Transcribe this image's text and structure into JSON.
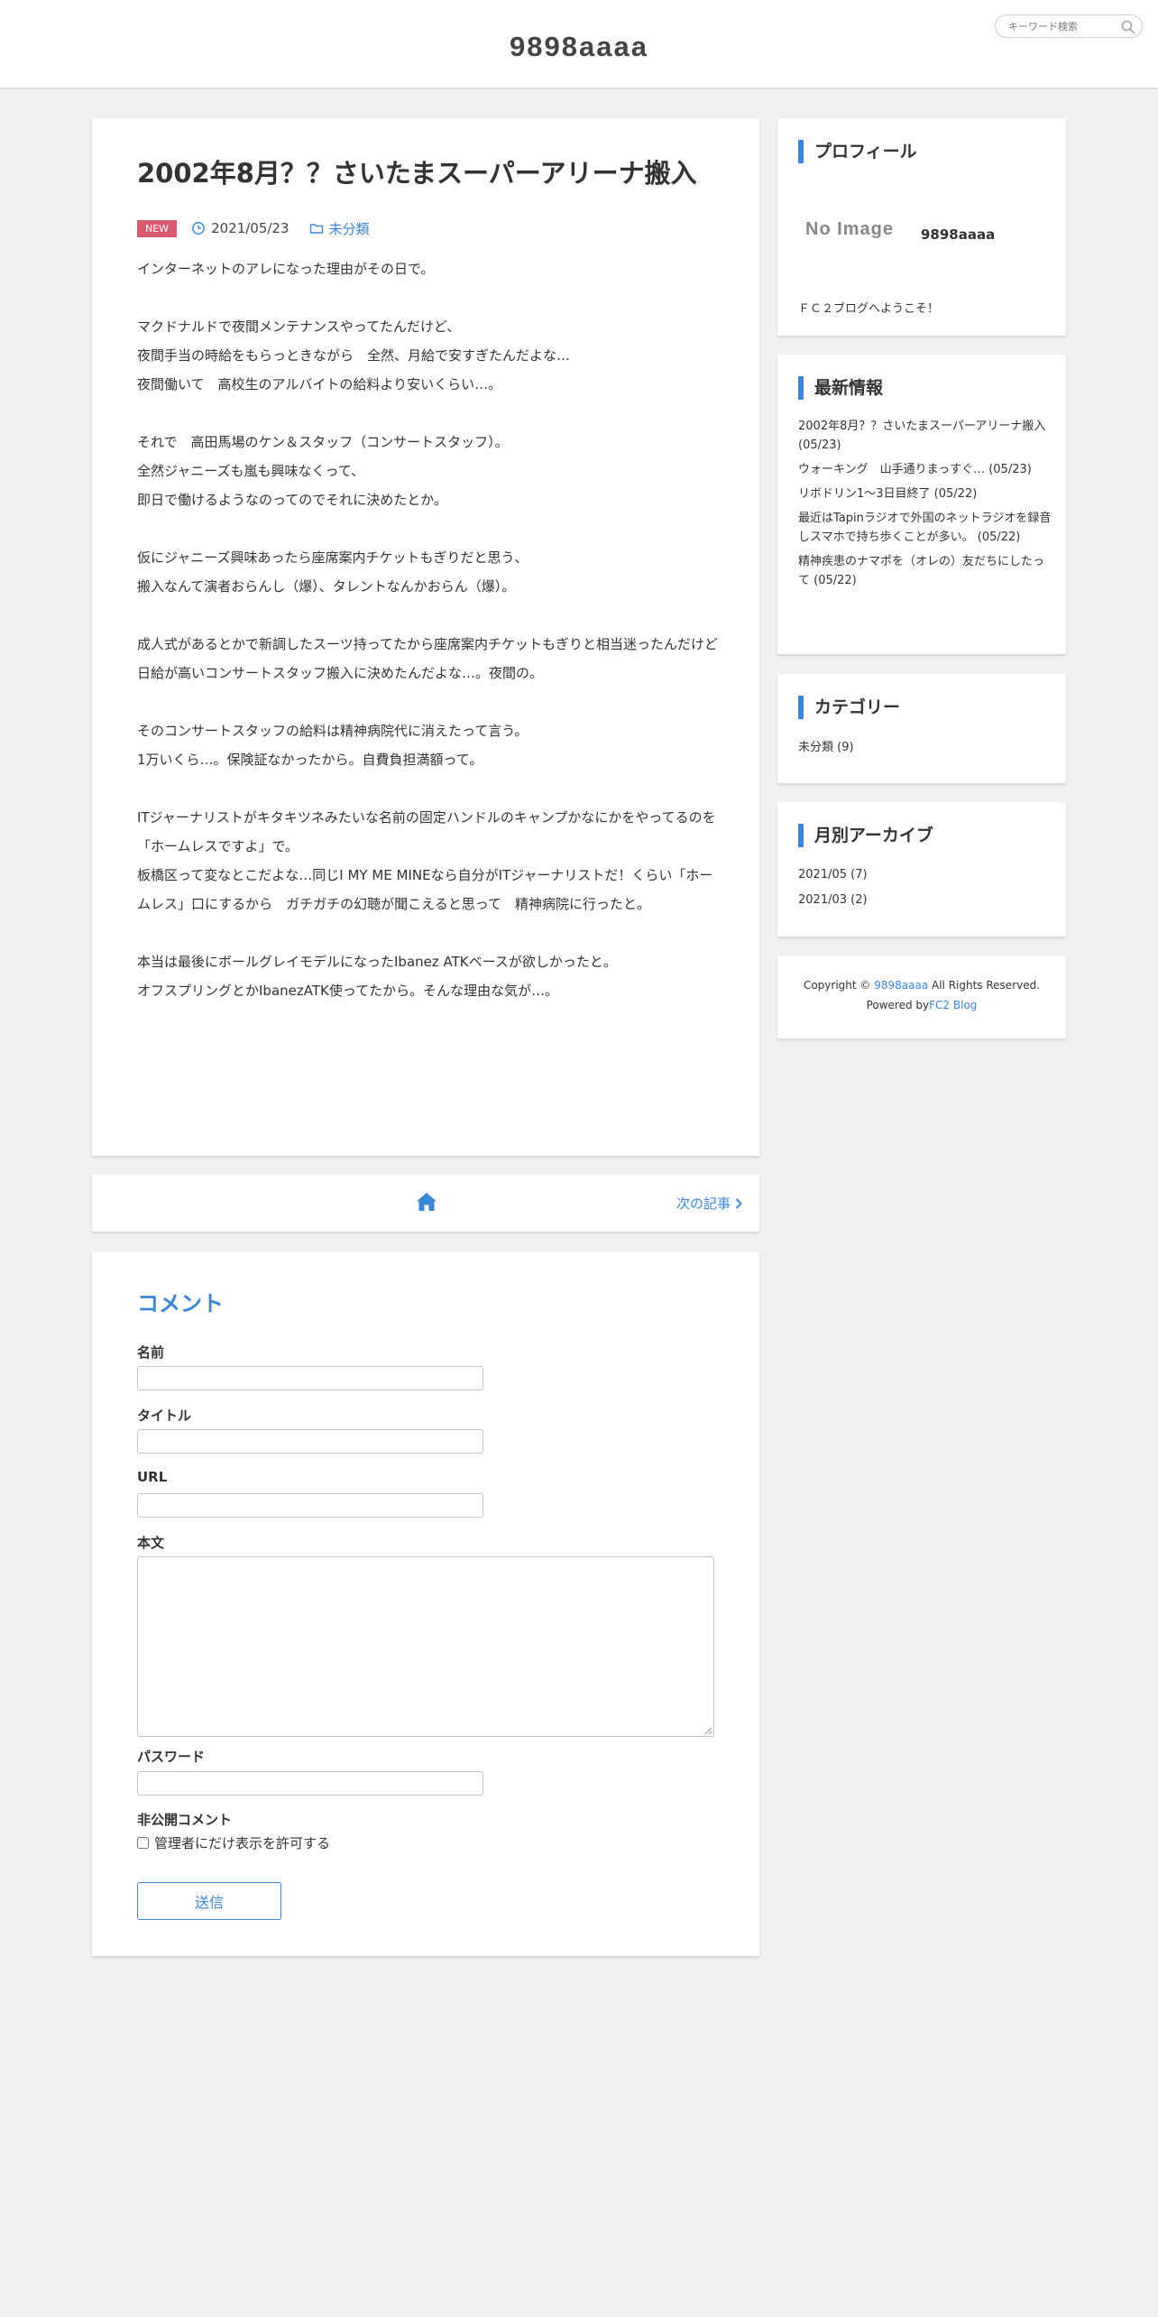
{
  "header": {
    "site_title": "9898aaaa",
    "search_placeholder": "キーワード検索"
  },
  "article": {
    "title": "2002年8月？？さいたまスーパーアリーナ搬入",
    "badge": "NEW",
    "date": "2021/05/23",
    "category": "未分類",
    "paragraphs": [
      [
        "インターネットのアレになった理由がその日で。"
      ],
      [
        "マクドナルドで夜間メンテナンスやってたんだけど、",
        "夜間手当の時給をもらっときながら　全然、月給で安すぎたんだよな…",
        "夜間働いて　高校生のアルバイトの給料より安いくらい…。"
      ],
      [
        "それで　高田馬場のケン＆スタッフ（コンサートスタッフ）。",
        "全然ジャニーズも嵐も興味なくって、",
        "即日で働けるようなのってのでそれに決めたとか。"
      ],
      [
        "仮にジャニーズ興味あったら座席案内チケットもぎりだと思う、",
        "搬入なんて演者おらんし（爆）、タレントなんかおらん（爆）。"
      ],
      [
        "成人式があるとかで新調したスーツ持ってたから座席案内チケットもぎりと相当迷ったんだけど日給が高いコンサートスタッフ搬入に決めたんだよな…。夜間の。"
      ],
      [
        "そのコンサートスタッフの給料は精神病院代に消えたって言う。",
        "1万いくら…。保険証なかったから。自費負担満額って。"
      ],
      [
        "ITジャーナリストがキタキツネみたいな名前の固定ハンドルのキャンプかなにかをやってるのを",
        "「ホームレスですよ」で。",
        "板橋区って変なとこだよな…同じI MY ME MINEなら自分がITジャーナリストだ！くらい「ホームレス」口にするから　ガチガチの幻聴が聞こえると思って　精神病院に行ったと。"
      ],
      [
        "本当は最後にボールグレイモデルになったIbanez ATKベースが欲しかったと。",
        "オフスプリングとかIbanezATK使ってたから。そんな理由な気が…。"
      ]
    ]
  },
  "pager": {
    "next_label": "次の記事"
  },
  "comment_form": {
    "heading": "コメント",
    "name_label": "名前",
    "title_label": "タイトル",
    "url_label": "URL",
    "body_label": "本文",
    "password_label": "パスワード",
    "private_label": "非公開コメント",
    "private_checkbox_label": "管理者にだけ表示を許可する",
    "submit_label": "送信"
  },
  "sidebar": {
    "profile": {
      "title": "プロフィール",
      "noimage": "No Image",
      "name": "9898aaaa",
      "greeting": "ＦＣ２ブログへようこそ！"
    },
    "news": {
      "title": "最新情報",
      "items": [
        "2002年8月？？さいたまスーパーアリーナ搬入 (05/23)",
        "ウォーキング　山手通りまっすぐ… (05/23)",
        "リボドリン1～3日目終了 (05/22)",
        "最近はTapinラジオで外国のネットラジオを録音しスマホで持ち歩くことが多い。 (05/22)",
        "精神疾患のナマポを（オレの）友だちにしたって (05/22)"
      ]
    },
    "categories": {
      "title": "カテゴリー",
      "items": [
        "未分類 (9)"
      ]
    },
    "archive": {
      "title": "月別アーカイブ",
      "items": [
        "2021/05 (7)",
        "2021/03 (2)"
      ]
    },
    "copyright": {
      "prefix": "Copyright ©",
      "site": "9898aaaa",
      "suffix": "All Rights Reserved.",
      "powered_prefix": "Powered by",
      "powered_link": "FC2 Blog"
    }
  },
  "colors": {
    "accent": "#3d86d6",
    "badge_new": "#d9596e",
    "background": "#f1f1f1"
  }
}
